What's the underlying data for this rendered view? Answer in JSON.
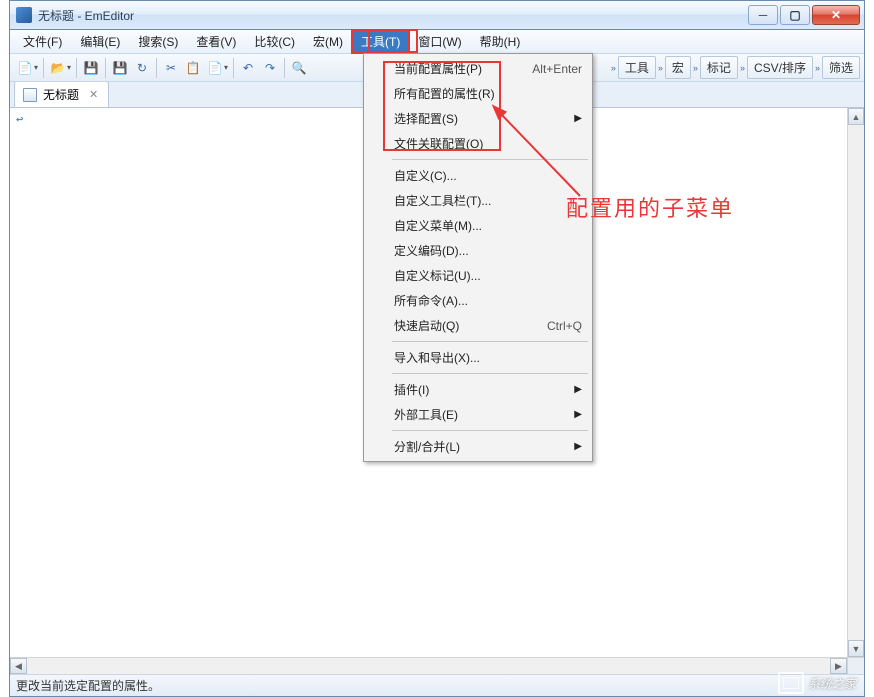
{
  "window": {
    "title": "无标题 - EmEditor"
  },
  "menubar": [
    {
      "label": "文件(F)",
      "active": false
    },
    {
      "label": "编辑(E)",
      "active": false
    },
    {
      "label": "搜索(S)",
      "active": false
    },
    {
      "label": "查看(V)",
      "active": false
    },
    {
      "label": "比较(C)",
      "active": false
    },
    {
      "label": "宏(M)",
      "active": false
    },
    {
      "label": "工具(T)",
      "active": true
    },
    {
      "label": "窗口(W)",
      "active": false
    },
    {
      "label": "帮助(H)",
      "active": false
    }
  ],
  "toolbar_right": [
    {
      "label": "工具"
    },
    {
      "label": "宏"
    },
    {
      "label": "标记"
    },
    {
      "label": "CSV/排序"
    },
    {
      "label": "筛选"
    }
  ],
  "tab": {
    "name": "无标题"
  },
  "editor": {
    "content": "↩"
  },
  "dropdown": [
    {
      "type": "item",
      "label": "当前配置属性(P)",
      "shortcut": "Alt+Enter"
    },
    {
      "type": "item",
      "label": "所有配置的属性(R)"
    },
    {
      "type": "submenu",
      "label": "选择配置(S)"
    },
    {
      "type": "item",
      "label": "文件关联配置(O)"
    },
    {
      "type": "sep"
    },
    {
      "type": "item",
      "label": "自定义(C)..."
    },
    {
      "type": "item",
      "label": "自定义工具栏(T)..."
    },
    {
      "type": "item",
      "label": "自定义菜单(M)..."
    },
    {
      "type": "item",
      "label": "定义编码(D)..."
    },
    {
      "type": "item",
      "label": "自定义标记(U)..."
    },
    {
      "type": "item",
      "label": "所有命令(A)..."
    },
    {
      "type": "item",
      "label": "快速启动(Q)",
      "shortcut": "Ctrl+Q"
    },
    {
      "type": "sep"
    },
    {
      "type": "item",
      "label": "导入和导出(X)..."
    },
    {
      "type": "sep"
    },
    {
      "type": "submenu",
      "label": "插件(I)"
    },
    {
      "type": "submenu",
      "label": "外部工具(E)"
    },
    {
      "type": "sep"
    },
    {
      "type": "submenu",
      "label": "分割/合并(L)"
    }
  ],
  "annotation": "配置用的子菜单",
  "statusbar": "更改当前选定配置的属性。",
  "watermark": "系统之家"
}
